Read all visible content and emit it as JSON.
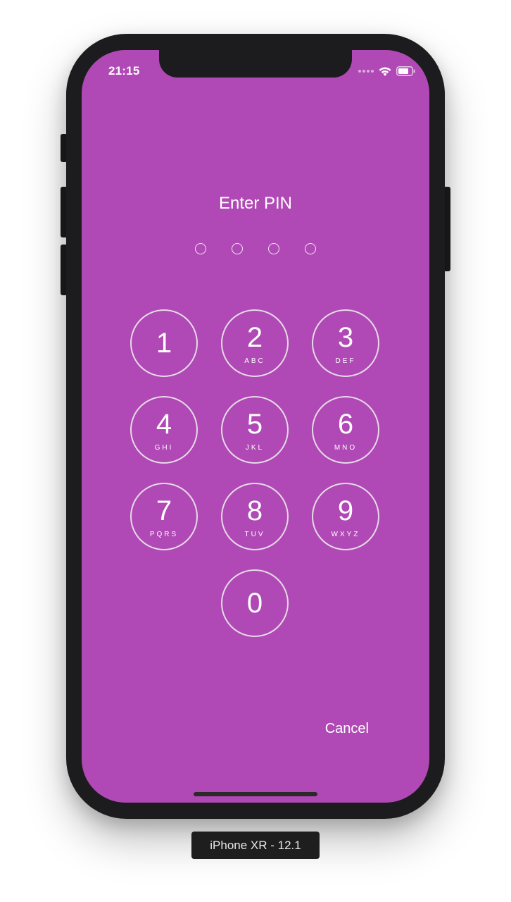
{
  "status_bar": {
    "time": "21:15",
    "signal_icon": "signal-dots-icon",
    "wifi_icon": "wifi-icon",
    "battery_icon": "battery-icon"
  },
  "pin_screen": {
    "title": "Enter PIN",
    "pin_length": 4,
    "entered_digits": 0,
    "background_color": "#b049b5",
    "keys": [
      {
        "digit": "1",
        "letters": ""
      },
      {
        "digit": "2",
        "letters": "ABC"
      },
      {
        "digit": "3",
        "letters": "DEF"
      },
      {
        "digit": "4",
        "letters": "GHI"
      },
      {
        "digit": "5",
        "letters": "JKL"
      },
      {
        "digit": "6",
        "letters": "MNO"
      },
      {
        "digit": "7",
        "letters": "PQRS"
      },
      {
        "digit": "8",
        "letters": "TUV"
      },
      {
        "digit": "9",
        "letters": "WXYZ"
      },
      {
        "digit": "0",
        "letters": ""
      }
    ],
    "cancel_label": "Cancel"
  },
  "simulator": {
    "device_label": "iPhone XR - 12.1"
  }
}
